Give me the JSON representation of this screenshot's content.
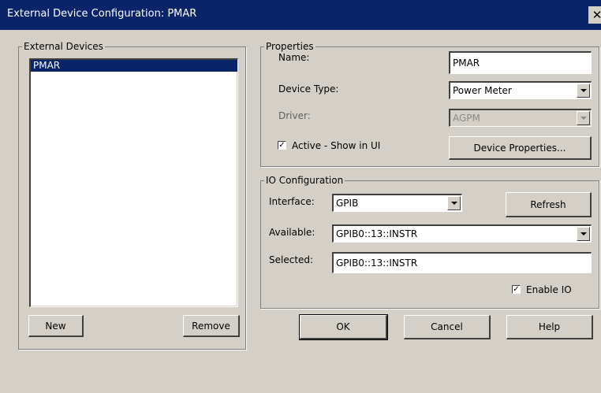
{
  "window": {
    "title": "External Device Configuration: PMAR",
    "close_glyph": "✕"
  },
  "devices": {
    "legend": "External Devices",
    "items": [
      {
        "label": "PMAR",
        "selected": true
      }
    ],
    "new_label": "New",
    "remove_label": "Remove"
  },
  "properties": {
    "legend": "Properties",
    "name_label": "Name:",
    "name_value": "PMAR",
    "device_type_label": "Device Type:",
    "device_type_value": "Power Meter",
    "driver_label": "Driver:",
    "driver_value": "AGPM",
    "active_label": "Active - Show in UI",
    "active_checked": true,
    "device_properties_label": "Device Properties..."
  },
  "io": {
    "legend": "IO Configuration",
    "interface_label": "Interface:",
    "interface_value": "GPIB",
    "refresh_label": "Refresh",
    "available_label": "Available:",
    "available_value": "GPIB0::13::INSTR",
    "selected_label": "Selected:",
    "selected_value": "GPIB0::13::INSTR",
    "enable_io_label": "Enable IO",
    "enable_io_checked": true
  },
  "footer": {
    "ok_label": "OK",
    "cancel_label": "Cancel",
    "help_label": "Help"
  },
  "icons": {
    "check": "✓"
  },
  "colors": {
    "title_bar": "#0a246a",
    "selection": "#0a246a",
    "face": "#d4d0c8"
  }
}
